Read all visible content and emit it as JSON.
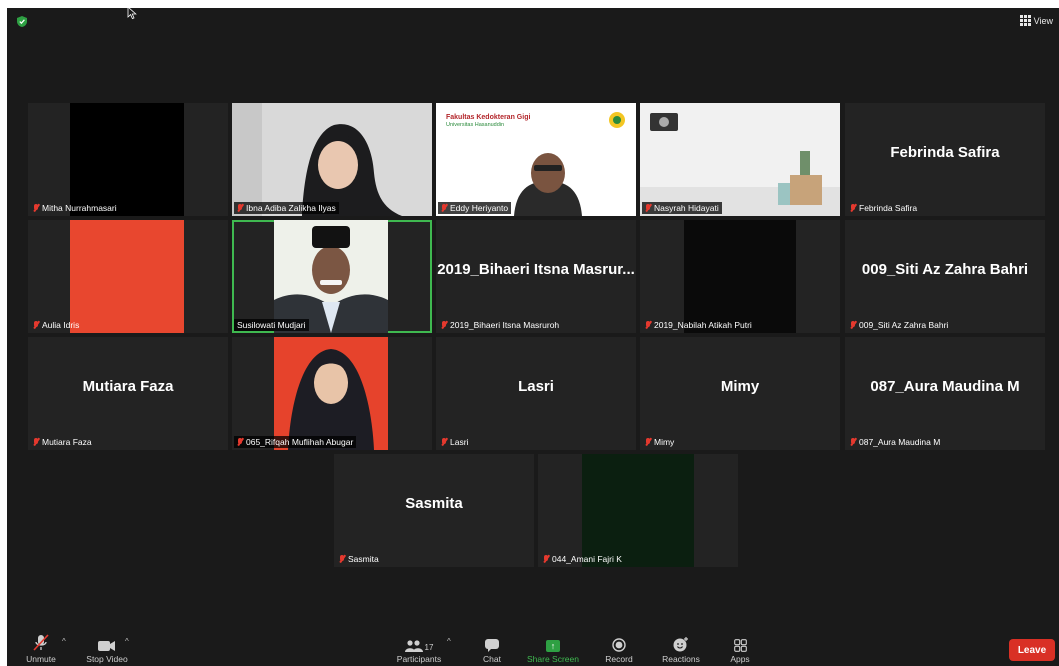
{
  "header": {
    "view_label": "View"
  },
  "participants": [
    {
      "name": "Mitha Nurrahmasari"
    },
    {
      "name": "Ibna Adiba Zalikha Ilyas"
    },
    {
      "name": "Eddy Heriyanto"
    },
    {
      "name": "Nasyrah Hidayati"
    },
    {
      "name": "Febrinda Safira",
      "center": "Febrinda Safira"
    },
    {
      "name": "Aulia Idris"
    },
    {
      "name": "Susilowati Mudjari"
    },
    {
      "name": "2019_Bihaeri Itsna Masruroh",
      "center": "2019_Bihaeri Itsna Masrur..."
    },
    {
      "name": "2019_Nabilah Atikah Putri"
    },
    {
      "name": "009_Siti Az Zahra Bahri",
      "center": "009_Siti Az Zahra Bahri"
    },
    {
      "name": "Mutiara Faza",
      "center": "Mutiara Faza"
    },
    {
      "name": "065_Rifqah Muflihah Abugar"
    },
    {
      "name": "Lasri",
      "center": "Lasri"
    },
    {
      "name": "Mimy",
      "center": "Mimy"
    },
    {
      "name": "087_Aura Maudina M",
      "center": "087_Aura Maudina M"
    },
    {
      "name": "Sasmita",
      "center": "Sasmita"
    },
    {
      "name": "044_Amani Fajri K"
    }
  ],
  "slide": {
    "title": "Fakultas Kedokteran Gigi",
    "subtitle": "Universitas Hasanuddin"
  },
  "toolbar": {
    "unmute": "Unmute",
    "stop_video": "Stop Video",
    "participants": "Participants",
    "participants_count": "17",
    "chat": "Chat",
    "share_screen": "Share Screen",
    "record": "Record",
    "reactions": "Reactions",
    "apps": "Apps",
    "leave": "Leave"
  },
  "colors": {
    "accent_green": "#3fb950",
    "leave_red": "#d93025",
    "muted_red": "#e5392e",
    "tile_bg": "#232323"
  }
}
